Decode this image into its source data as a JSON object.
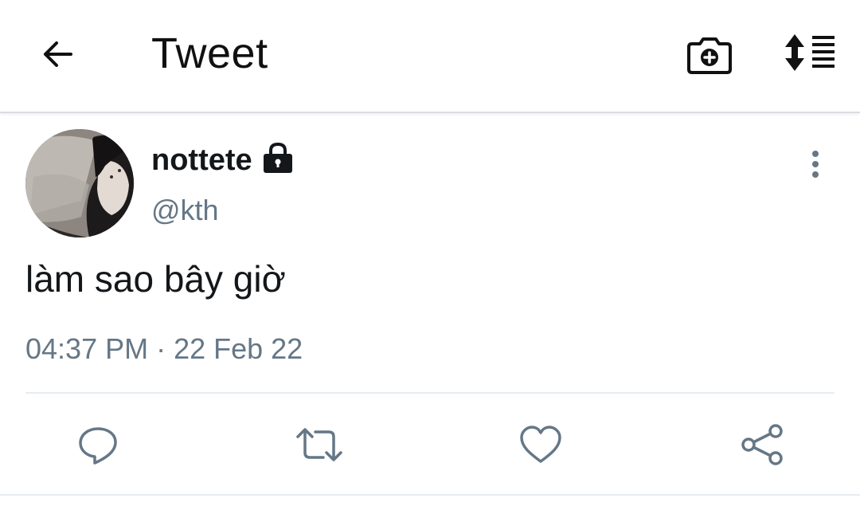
{
  "header": {
    "title": "Tweet",
    "icons": {
      "back": "back-arrow-icon",
      "camera": "camera-add-icon",
      "sort": "sort-lines-icon"
    }
  },
  "tweet": {
    "author": {
      "display_name": "nottete",
      "handle": "@kth",
      "protected": true
    },
    "text": "làm sao bây giờ",
    "timestamp": "04:37 PM · 22 Feb 22"
  },
  "actions": [
    {
      "name": "reply",
      "icon": "reply-bubble-icon"
    },
    {
      "name": "retweet",
      "icon": "retweet-icon"
    },
    {
      "name": "like",
      "icon": "heart-icon"
    },
    {
      "name": "share",
      "icon": "share-icon"
    }
  ],
  "colors": {
    "primary_text": "#14171a",
    "secondary_text": "#657786",
    "icon_gray": "#657786",
    "divider": "#e6ecf0"
  }
}
